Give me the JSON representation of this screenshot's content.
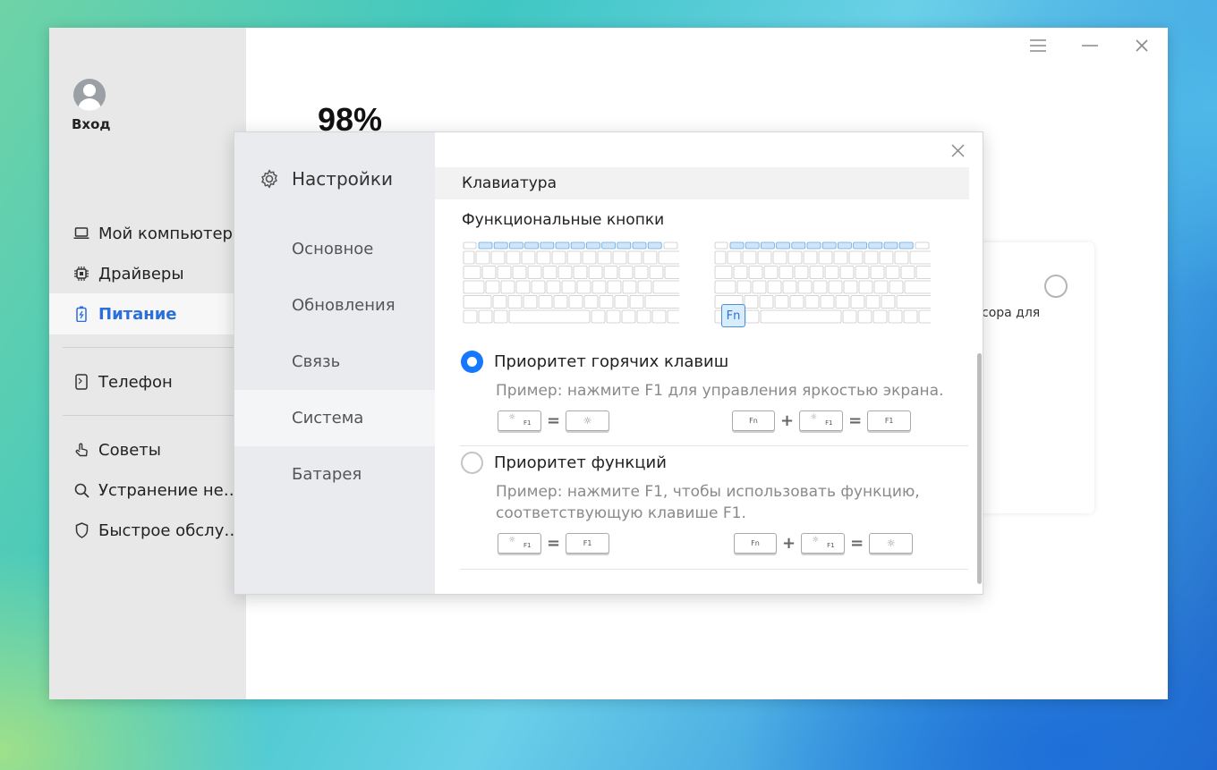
{
  "app": {
    "user": {
      "login_label": "Вход"
    },
    "nav": [
      {
        "label": "Мой компьютер",
        "icon": "laptop-icon"
      },
      {
        "label": "Драйверы",
        "icon": "chip-icon"
      },
      {
        "label": "Питание",
        "icon": "battery-icon",
        "active": true
      },
      {
        "label": "Телефон",
        "icon": "phone-icon"
      },
      {
        "label": "Советы",
        "icon": "hand-icon"
      },
      {
        "label": "Устранение не…",
        "icon": "search-icon"
      },
      {
        "label": "Быстрое обслу…",
        "icon": "shield-icon"
      }
    ],
    "window_controls": [
      "menu-icon",
      "minimize-icon",
      "close-icon"
    ],
    "background": {
      "battery_value": "98%",
      "card_text": "сора для"
    }
  },
  "dialog": {
    "title": "Настройки",
    "nav": [
      {
        "label": "Основное"
      },
      {
        "label": "Обновления"
      },
      {
        "label": "Связь"
      },
      {
        "label": "Система",
        "active": true
      },
      {
        "label": "Батарея"
      }
    ],
    "section_header": "Клавиатура",
    "subheading": "Функциональные кнопки",
    "fn_key_label": "Fn",
    "options": [
      {
        "title": "Приоритет горячих клавиш",
        "selected": true,
        "description": "Пример: нажмите F1 для управления яркостью экрана.",
        "formula_left": {
          "key1": "F1",
          "result": "sun"
        },
        "formula_right": {
          "key1": "Fn",
          "key2": "F1",
          "result": "F1"
        }
      },
      {
        "title": "Приоритет функций",
        "selected": false,
        "description": "Пример: нажмите F1, чтобы использовать функцию, соответствующую клавише F1.",
        "formula_left": {
          "key1": "F1",
          "result": "F1"
        },
        "formula_right": {
          "key1": "Fn",
          "key2": "F1",
          "result": "sun"
        }
      }
    ],
    "colors": {
      "accent": "#1677ff",
      "active_nav": "#2a6fdb",
      "highlight_key": "#cfe6fa"
    }
  }
}
